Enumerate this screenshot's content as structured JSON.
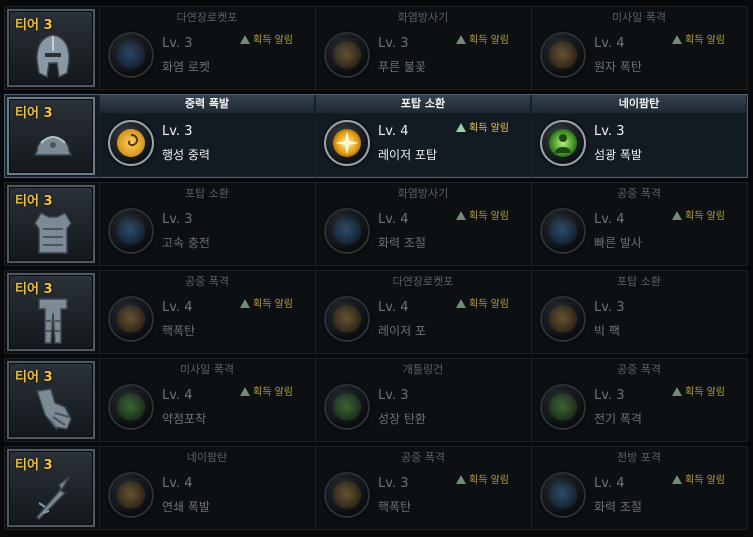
{
  "rows": [
    {
      "tier_label": "티어 3",
      "armor": "helmet-icon",
      "cells": [
        {
          "head": "다연장로켓포",
          "level": "Lv. 3",
          "name": "화염 로켓",
          "notify": "획득 알림",
          "icon": "flame-icon",
          "color": "#3a7ad8"
        },
        {
          "head": "화염방사기",
          "level": "Lv. 3",
          "name": "푸른 불꽃",
          "notify": "획득 알림",
          "icon": "blue-flame-icon",
          "color": "#d89a3a"
        },
        {
          "head": "미사일 폭격",
          "level": "Lv. 4",
          "name": "원자 폭탄",
          "notify": "획득 알림",
          "icon": "atom-bomb-icon",
          "color": "#e0a030"
        }
      ]
    },
    {
      "tier_label": "티어 3",
      "armor": "cap-helmet-icon",
      "active": true,
      "cells": [
        {
          "head": "중력 폭발",
          "level": "Lv. 3",
          "name": "행성 중력",
          "notify": "",
          "icon": "gravity-swirl-icon",
          "color": "#f0b020"
        },
        {
          "head": "포탑 소환",
          "level": "Lv. 4",
          "name": "레이저 포탑",
          "notify": "획득 알림",
          "icon": "laser-burst-icon",
          "color": "#f5c040"
        },
        {
          "head": "네이팜탄",
          "level": "Lv. 3",
          "name": "섬광 폭발",
          "notify": "",
          "icon": "flash-figure-icon",
          "color": "#6cd040"
        }
      ]
    },
    {
      "tier_label": "티어 3",
      "armor": "chest-armor-icon",
      "cells": [
        {
          "head": "포탑 소환",
          "level": "Lv. 3",
          "name": "고속 충전",
          "notify": "",
          "icon": "hourglass-icon",
          "color": "#3a8ad8"
        },
        {
          "head": "화염방사기",
          "level": "Lv. 4",
          "name": "화력 조절",
          "notify": "획득 알림",
          "icon": "arrow-up-icon",
          "color": "#3a8ad8"
        },
        {
          "head": "공중 폭격",
          "level": "Lv. 4",
          "name": "빠른 발사",
          "notify": "획득 알림",
          "icon": "rapid-fire-icon",
          "color": "#3a8ad8"
        }
      ]
    },
    {
      "tier_label": "티어 3",
      "armor": "leg-armor-icon",
      "cells": [
        {
          "head": "공중 폭격",
          "level": "Lv. 4",
          "name": "핵폭탄",
          "notify": "획득 알림",
          "icon": "nuke-icon",
          "color": "#e0a030"
        },
        {
          "head": "다연장로켓포",
          "level": "Lv. 4",
          "name": "레이저 포",
          "notify": "획득 알림",
          "icon": "laser-beam-icon",
          "color": "#e0a030"
        },
        {
          "head": "포탑 소환",
          "level": "Lv. 3",
          "name": "빅 팩",
          "notify": "",
          "icon": "orb-burst-icon",
          "color": "#e0a030"
        }
      ]
    },
    {
      "tier_label": "티어 3",
      "armor": "gauntlet-icon",
      "cells": [
        {
          "head": "미사일 폭격",
          "level": "Lv. 4",
          "name": "약점포착",
          "notify": "획득 알림",
          "icon": "target-icon",
          "color": "#6cd040"
        },
        {
          "head": "개틀링건",
          "level": "Lv. 3",
          "name": "성장 탄환",
          "notify": "",
          "icon": "grass-icon",
          "color": "#6cd040"
        },
        {
          "head": "공중 폭격",
          "level": "Lv. 3",
          "name": "전기 폭격",
          "notify": "획득 알림",
          "icon": "lightning-icon",
          "color": "#6cd040"
        }
      ]
    },
    {
      "tier_label": "티어 3",
      "armor": "spear-icon",
      "cells": [
        {
          "head": "네이팜탄",
          "level": "Lv. 4",
          "name": "연쇄 폭발",
          "notify": "",
          "icon": "chain-burst-icon",
          "color": "#e0a030"
        },
        {
          "head": "공중 폭격",
          "level": "Lv. 3",
          "name": "핵폭탄",
          "notify": "획득 알림",
          "icon": "nuke-icon",
          "color": "#e0a030"
        },
        {
          "head": "전방 포격",
          "level": "Lv. 4",
          "name": "화력 조절",
          "notify": "획득 알림",
          "icon": "arrow-up-icon",
          "color": "#3a8ad8"
        }
      ]
    }
  ]
}
